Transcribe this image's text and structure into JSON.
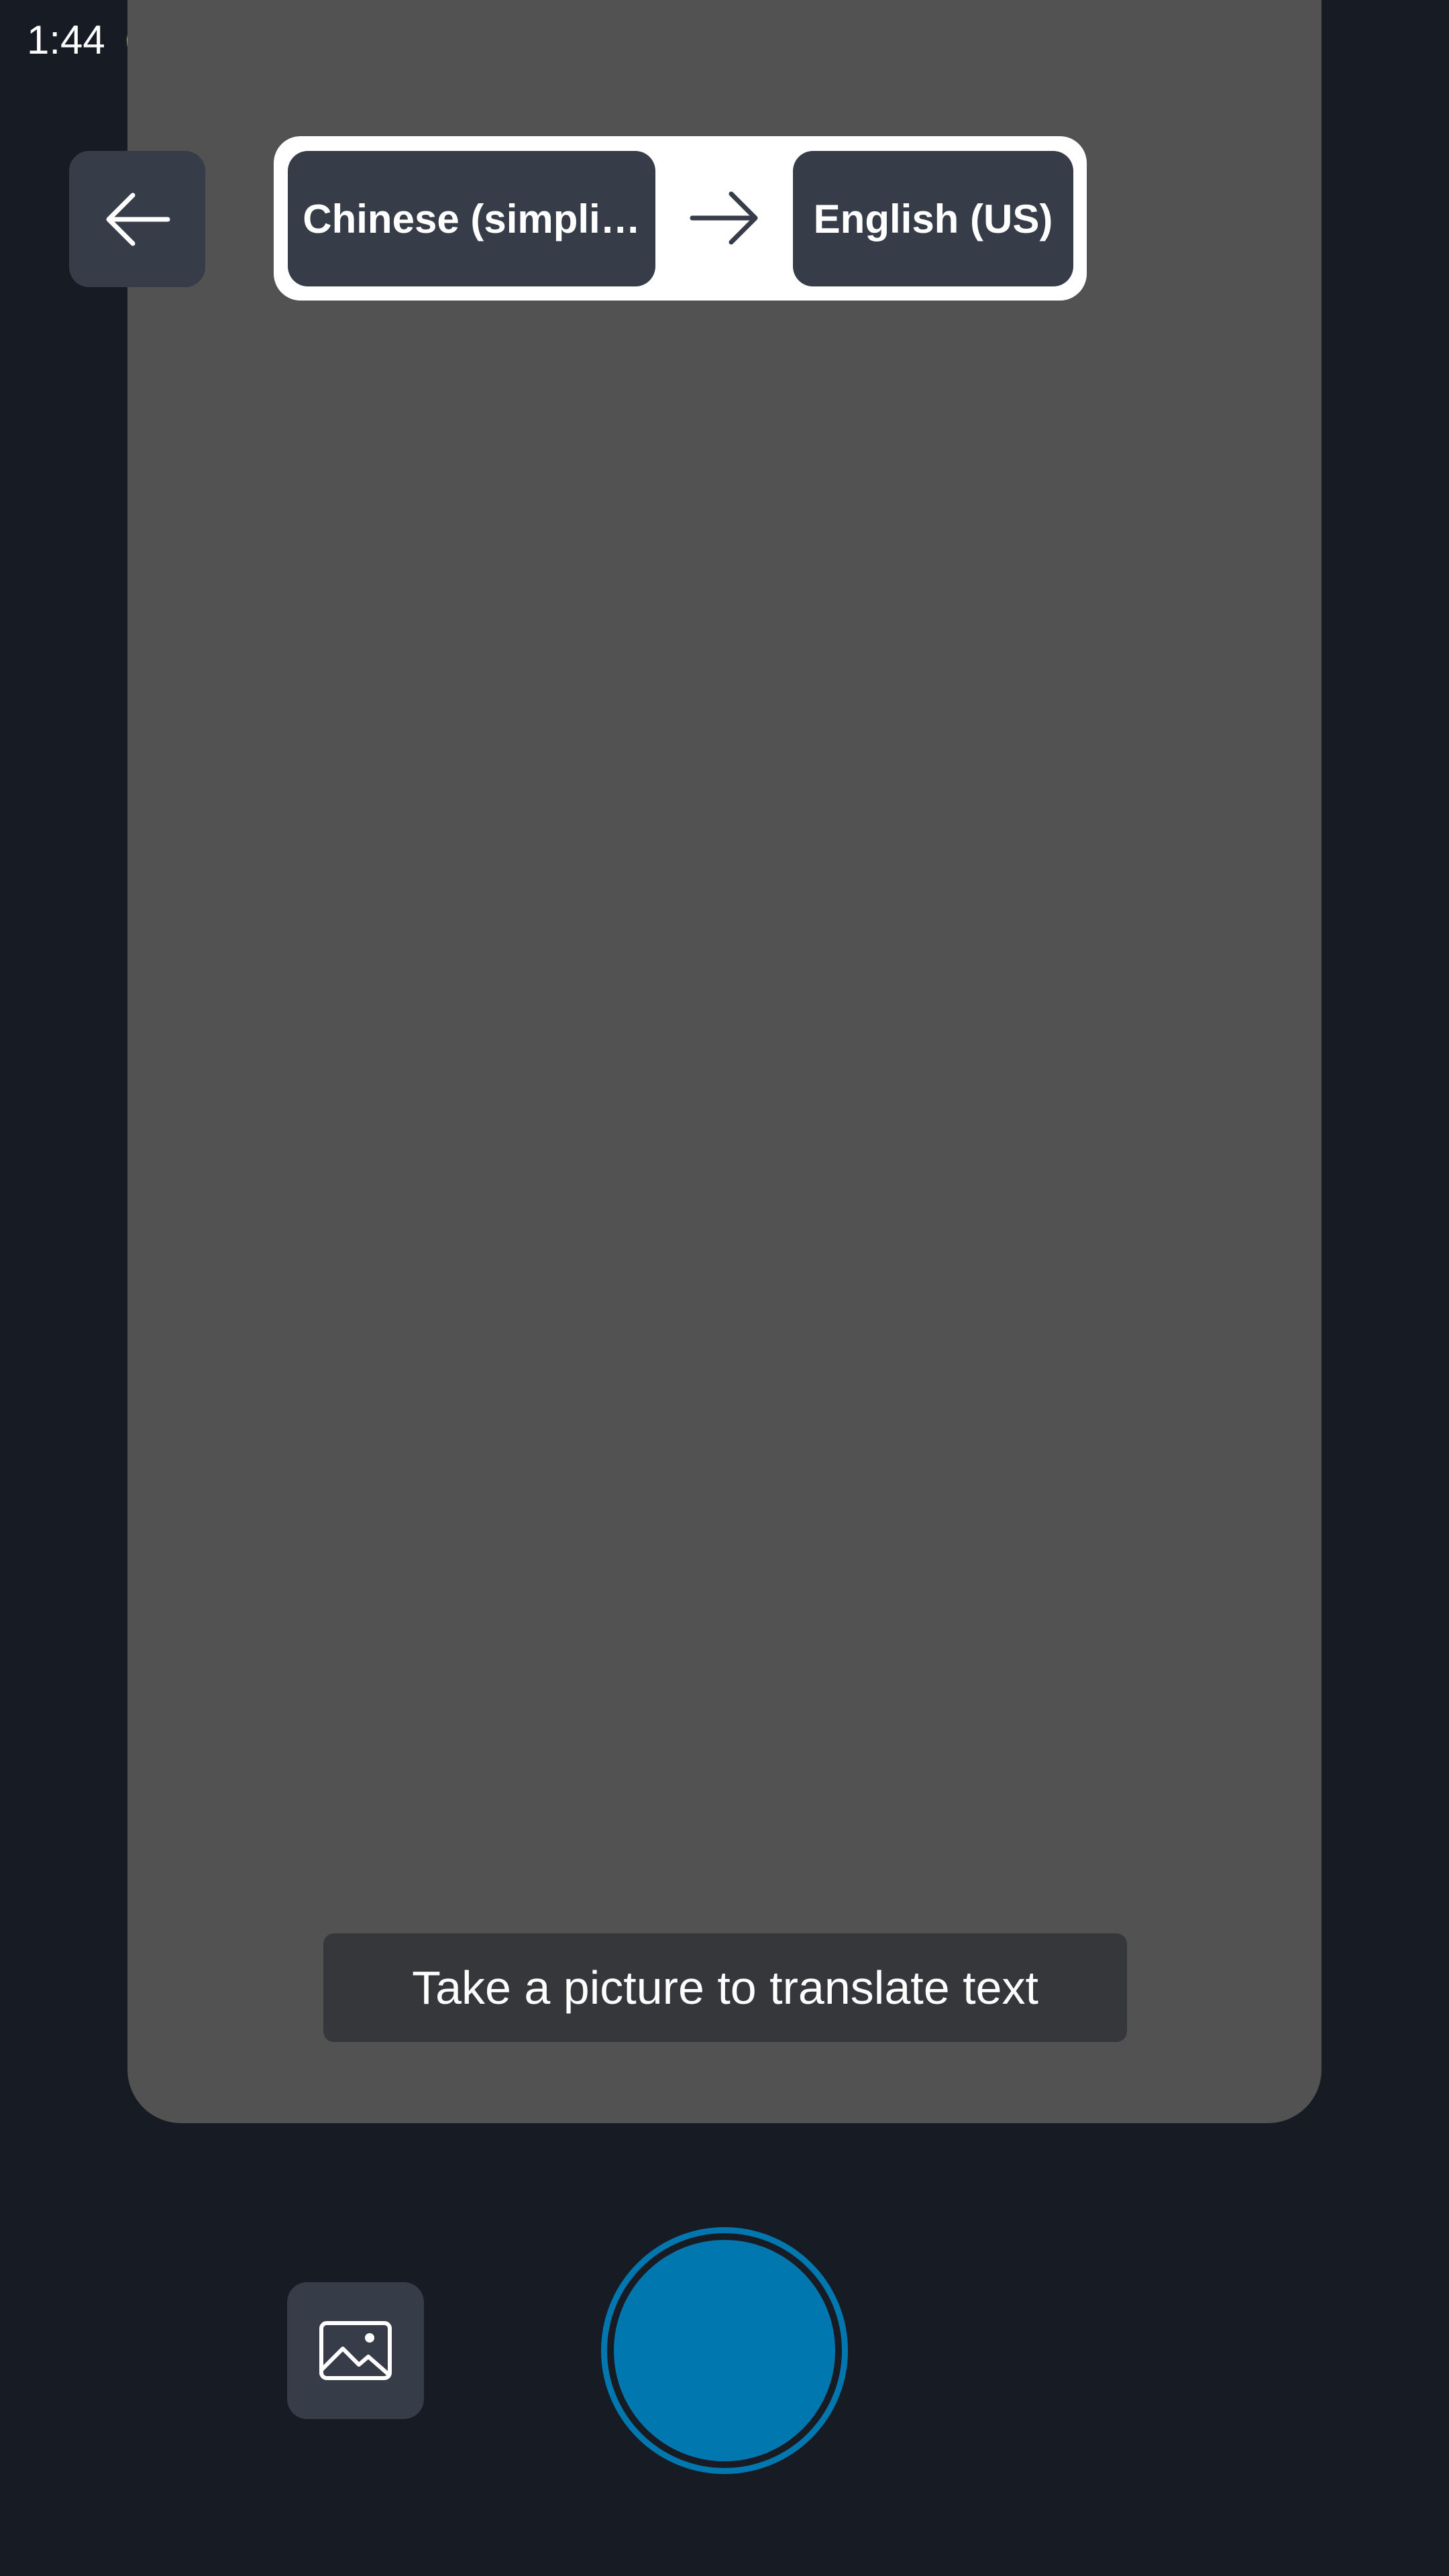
{
  "status_bar": {
    "time": "1:44",
    "app_icon": "translator-logo-icon"
  },
  "header": {
    "back_icon": "arrow-left-icon",
    "source_language": "Chinese (simpli…",
    "target_language": "English (US)",
    "direction_icon": "arrow-right-icon"
  },
  "viewfinder": {
    "hint": "Take a picture to translate text"
  },
  "controls": {
    "gallery_icon": "image-gallery-icon",
    "shutter_icon": "shutter-button"
  },
  "colors": {
    "background": "#171c24",
    "viewfinder": "#525252",
    "button_bg": "#363c48",
    "accent": "#0077ae",
    "hint_bg": "#36373b"
  }
}
